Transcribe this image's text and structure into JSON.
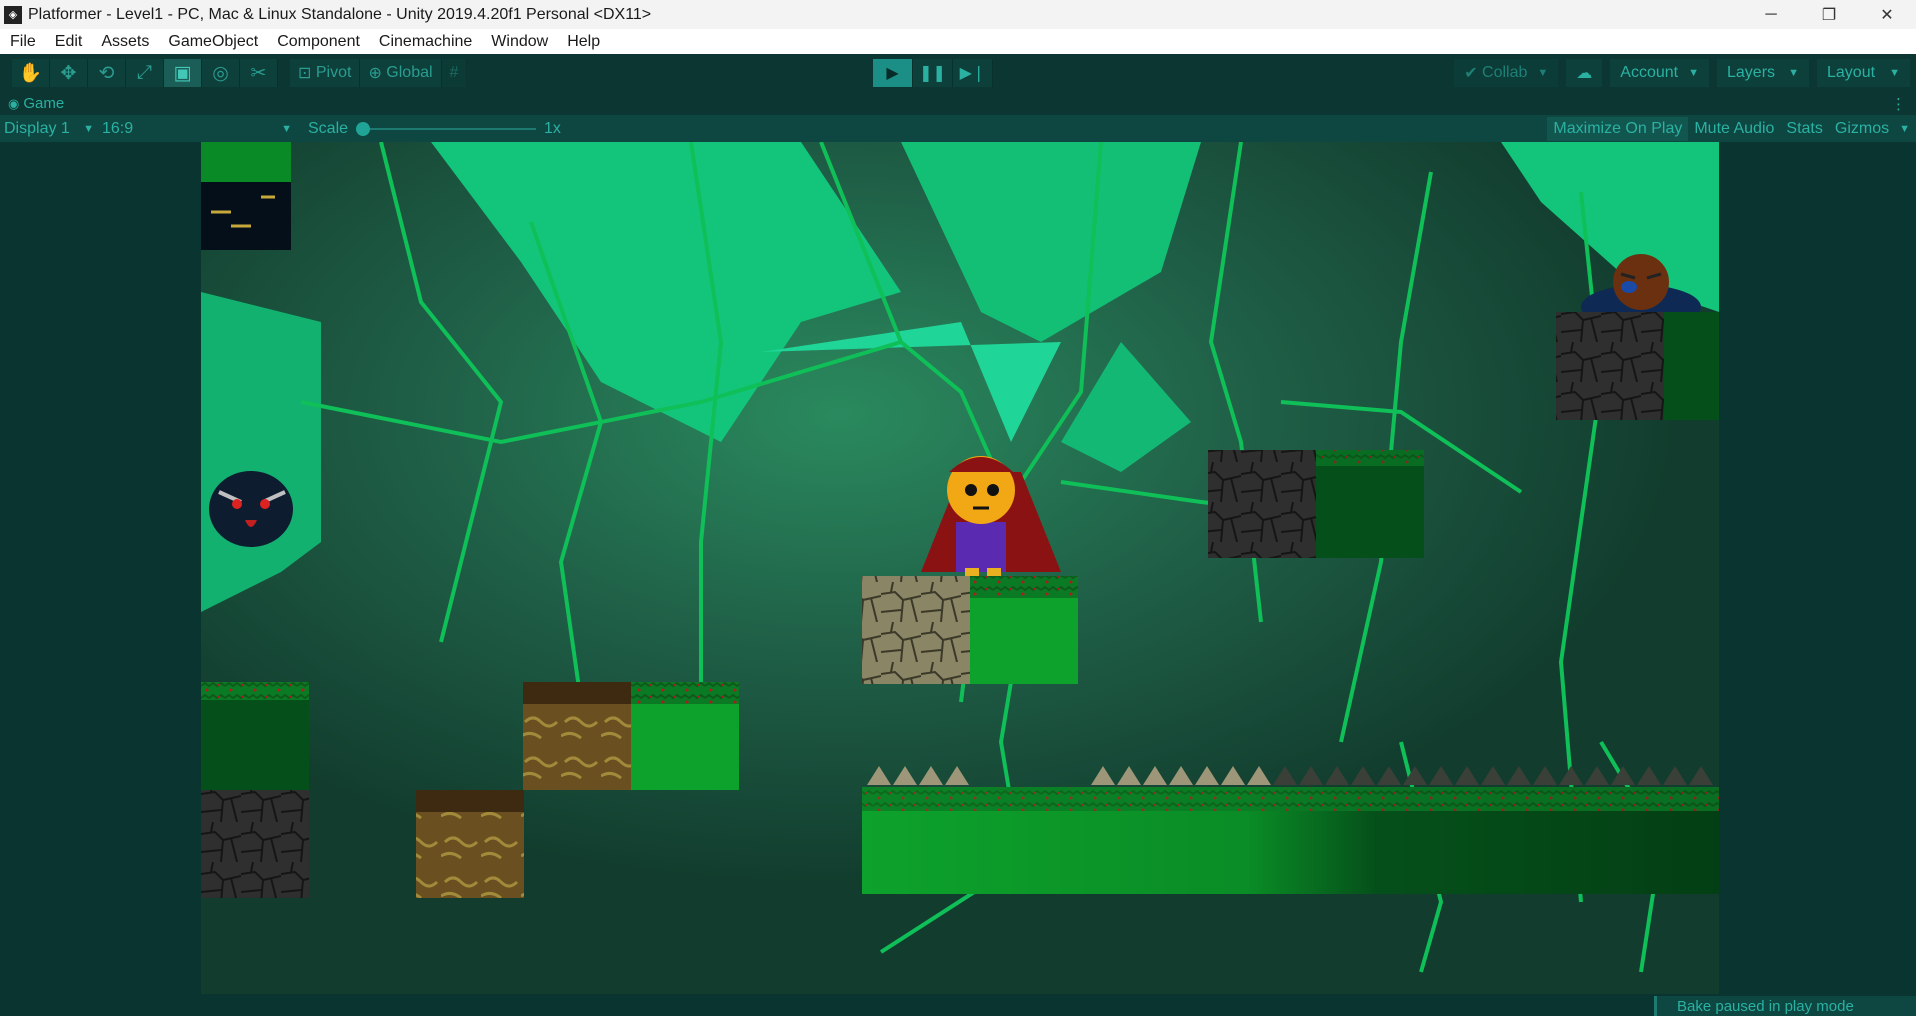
{
  "window": {
    "title": "Platformer - Level1 - PC, Mac & Linux Standalone - Unity 2019.4.20f1 Personal <DX11>",
    "controls": {
      "minimize": "─",
      "restore": "❐",
      "close": "✕"
    }
  },
  "menu": {
    "items": [
      "File",
      "Edit",
      "Assets",
      "GameObject",
      "Component",
      "Cinemachine",
      "Window",
      "Help"
    ]
  },
  "toolbar": {
    "tools": [
      {
        "name": "hand-tool",
        "glyph": "✋"
      },
      {
        "name": "move-tool",
        "glyph": "✥"
      },
      {
        "name": "rotate-tool",
        "glyph": "⟲"
      },
      {
        "name": "scale-tool",
        "glyph": "⤢"
      },
      {
        "name": "rect-tool",
        "glyph": "▣"
      },
      {
        "name": "transform-tool",
        "glyph": "◎"
      },
      {
        "name": "custom-tool",
        "glyph": "✂"
      }
    ],
    "active_tool": 4,
    "pivot_label": "Pivot",
    "global_label": "Global",
    "grid_glyph": "#",
    "play_glyph": "▶",
    "pause_glyph": "❚❚",
    "step_glyph": "▶❘",
    "collab_label": "Collab",
    "cloud_glyph": "☁",
    "account_label": "Account",
    "layers_label": "Layers",
    "layout_label": "Layout",
    "caret": "▼"
  },
  "tab": {
    "label": "Game",
    "eye_glyph": "◉",
    "kebab": "⋮"
  },
  "gamebar": {
    "display": "Display 1",
    "aspect": "16:9",
    "scale_label": "Scale",
    "scale_value": "1x",
    "scale_slider_fraction": 0.0,
    "maximize_label": "Maximize On Play",
    "mute_label": "Mute Audio",
    "stats_label": "Stats",
    "gizmos_label": "Gizmos"
  },
  "status": {
    "message": "Bake paused in play mode"
  },
  "colors": {
    "editor_bg": "#0b3632",
    "accent": "#2ab1a2",
    "play_active": "#1b8f86",
    "sky_glow": "#1fd597",
    "grass": "#0fa02b"
  }
}
